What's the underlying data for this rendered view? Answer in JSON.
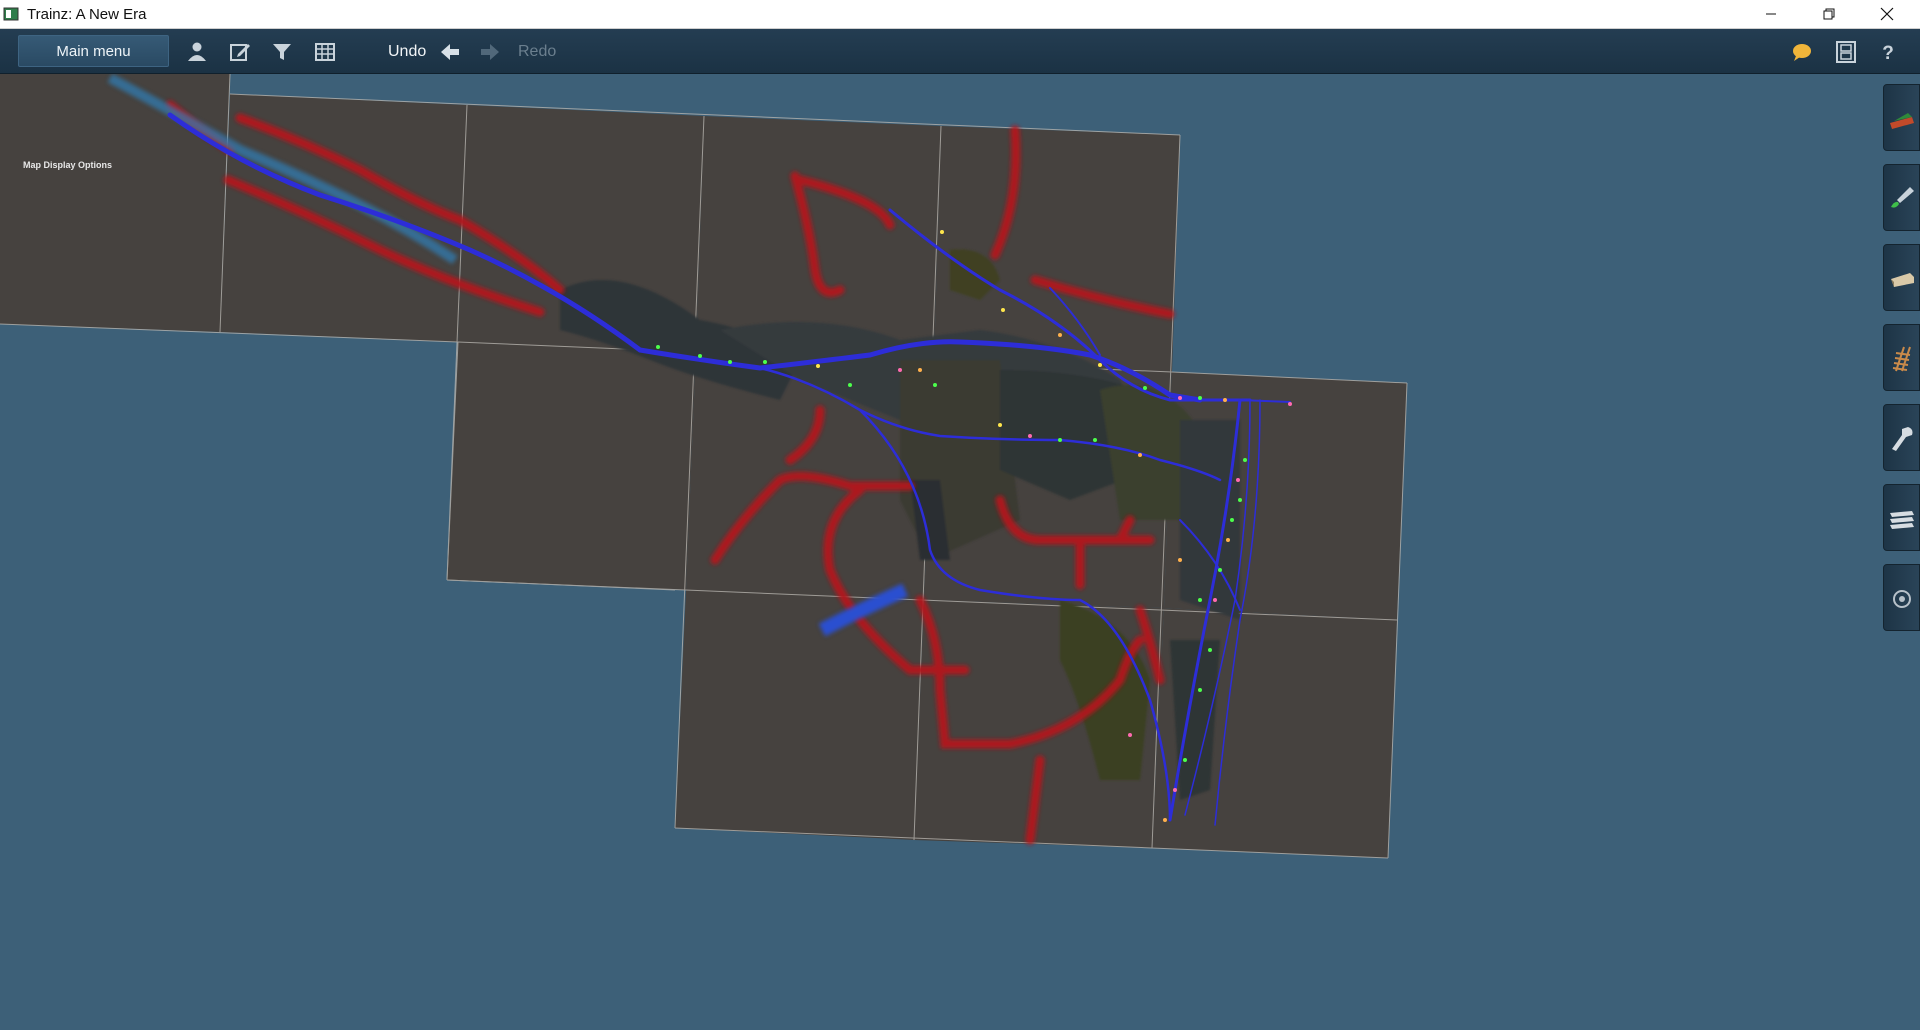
{
  "window": {
    "title": "Trainz: A New Era"
  },
  "toolbar": {
    "main_menu_label": "Main menu",
    "undo_label": "Undo",
    "redo_label": "Redo"
  },
  "map": {
    "display_options_label": "Map Display Options"
  },
  "colors": {
    "background": "#3d6078",
    "toolbar": "#1f374a",
    "terrain_tile": "#46423f",
    "road": "#b3171c",
    "track": "#2d2dd8",
    "river": "#2c7fb8"
  },
  "icons": {
    "toolbar": [
      "person-icon",
      "edit-icon",
      "filter-icon",
      "grid-icon",
      "undo-arrow-icon",
      "redo-arrow-icon",
      "chat-bubble-icon",
      "film-strip-icon",
      "help-icon"
    ],
    "palette": [
      "train-icon",
      "paint-brush-icon",
      "locomotive-icon",
      "track-icon",
      "wrench-icon",
      "layers-icon",
      "settings-icon"
    ]
  }
}
